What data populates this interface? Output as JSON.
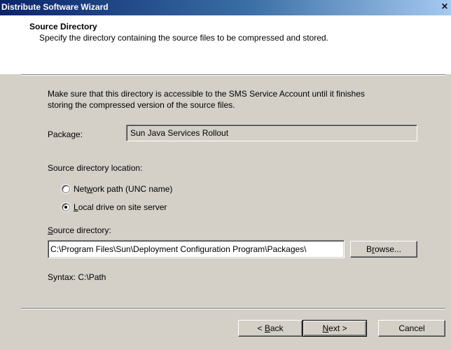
{
  "window": {
    "title": "Distribute Software Wizard",
    "close_label": "×"
  },
  "header": {
    "title": "Source Directory",
    "subtitle": "Specify the directory containing the source files to be compressed and stored."
  },
  "body": {
    "instruction_line1": "Make sure that this directory is accessible to the SMS Service Account until it finishes",
    "instruction_line2": "storing the compressed version of the source files.",
    "package_label": "Package:",
    "package_value": "Sun Java Services Rollout",
    "location_label": "Source directory location:",
    "radio_network": {
      "pre": "Net",
      "key": "w",
      "post": "ork path (UNC name)",
      "checked": false
    },
    "radio_local": {
      "pre": "",
      "key": "L",
      "post": "ocal drive on site server",
      "checked": true
    },
    "source_label": {
      "pre": "",
      "key": "S",
      "post": "ource directory:"
    },
    "source_value": "C:\\Program Files\\Sun\\Deployment Configuration Program\\Packages\\",
    "browse_button": {
      "pre": "B",
      "key": "r",
      "post": "owse..."
    },
    "syntax": "Syntax: C:\\Path"
  },
  "footer": {
    "back_button": {
      "pre": "< ",
      "key": "B",
      "post": "ack"
    },
    "next_button": {
      "pre": "",
      "key": "N",
      "post": "ext >"
    },
    "cancel_button": "Cancel"
  }
}
